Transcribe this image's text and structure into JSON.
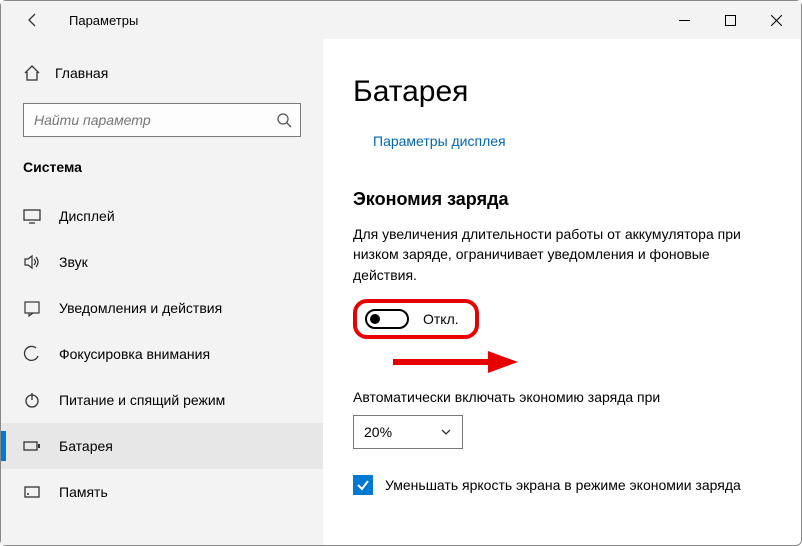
{
  "window": {
    "title": "Параметры"
  },
  "search": {
    "placeholder": "Найти параметр"
  },
  "sidebar": {
    "home_label": "Главная",
    "section": "Система",
    "items": [
      {
        "label": "Дисплей"
      },
      {
        "label": "Звук"
      },
      {
        "label": "Уведомления и действия"
      },
      {
        "label": "Фокусировка внимания"
      },
      {
        "label": "Питание и спящий режим"
      },
      {
        "label": "Батарея"
      },
      {
        "label": "Память"
      }
    ]
  },
  "page": {
    "title": "Батарея",
    "display_link": "Параметры дисплея",
    "section_title": "Экономия заряда",
    "description": "Для увеличения длительности работы от аккумулятора при низком заряде, ограничивает уведомления и фоновые действия.",
    "toggle_state": "Откл.",
    "auto_label": "Автоматически включать экономию заряда при",
    "auto_value": "20%",
    "checkbox_label": "Уменьшать яркость экрана в режиме экономии заряда"
  },
  "annotation": {
    "highlight_color": "#e60000"
  }
}
